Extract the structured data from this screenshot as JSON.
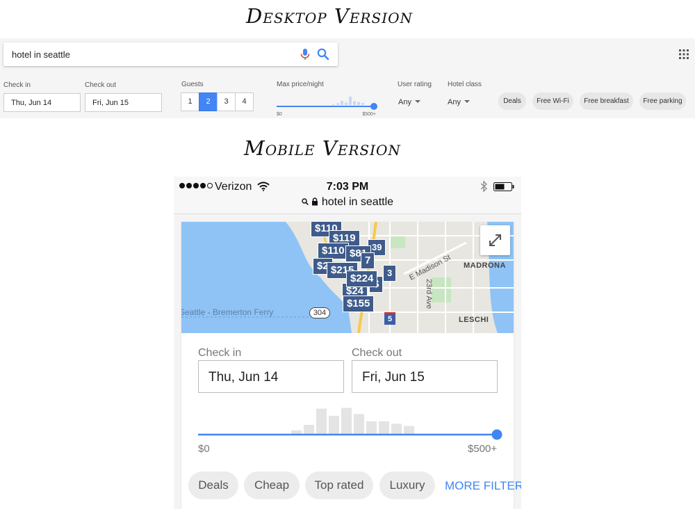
{
  "desktop_heading": "Desktop Version",
  "mobile_heading": "Mobile Version",
  "desktop": {
    "search_query": "hotel in seattle",
    "check_in_label": "Check in",
    "check_in_value": "Thu, Jun 14",
    "check_out_label": "Check out",
    "check_out_value": "Fri, Jun 15",
    "guests_label": "Guests",
    "guest_options": [
      "1",
      "2",
      "3",
      "4"
    ],
    "guests_selected": "2",
    "max_price_label": "Max price/night",
    "price_min": "$0",
    "price_max": "$500+",
    "price_slider_fraction": 1.0,
    "histogram": [
      0.05,
      0.12,
      0.3,
      0.18,
      0.6,
      0.28,
      0.22,
      0.15
    ],
    "user_rating_label": "User rating",
    "user_rating_value": "Any",
    "hotel_class_label": "Hotel class",
    "hotel_class_value": "Any",
    "filter_chips": [
      "Deals",
      "Free Wi-Fi",
      "Free breakfast",
      "Free parking"
    ],
    "accent_color": "#4285f4"
  },
  "mobile": {
    "carrier": "Verizon",
    "signal_bars_filled": 4,
    "time": "7:03 PM",
    "url": "hotel in seattle",
    "map": {
      "price_pins": [
        "$110",
        "$119",
        "$110",
        "$81",
        "$2",
        "$215",
        "$224",
        "$24",
        "$155",
        "$",
        "39",
        "7",
        "3"
      ],
      "street_labels": [
        "E Madison St",
        "23rd Ave",
        "MADRONA",
        "LESCHI",
        "Seattle - Bremerton Ferry"
      ],
      "route_shields": [
        "304",
        "5"
      ],
      "pin_color": "#3e5b8a"
    },
    "check_in_label": "Check in",
    "check_in_value": "Thu, Jun 14",
    "check_out_label": "Check out",
    "check_out_value": "Fri, Jun 15",
    "histogram": [
      0.1,
      0.25,
      0.7,
      0.5,
      0.72,
      0.55,
      0.35,
      0.35,
      0.28,
      0.22
    ],
    "price_min": "$0",
    "price_max": "$500+",
    "price_slider_fraction": 1.0,
    "filter_chips": [
      "Deals",
      "Cheap",
      "Top rated",
      "Luxury"
    ],
    "more_filters": "MORE FILTER"
  }
}
